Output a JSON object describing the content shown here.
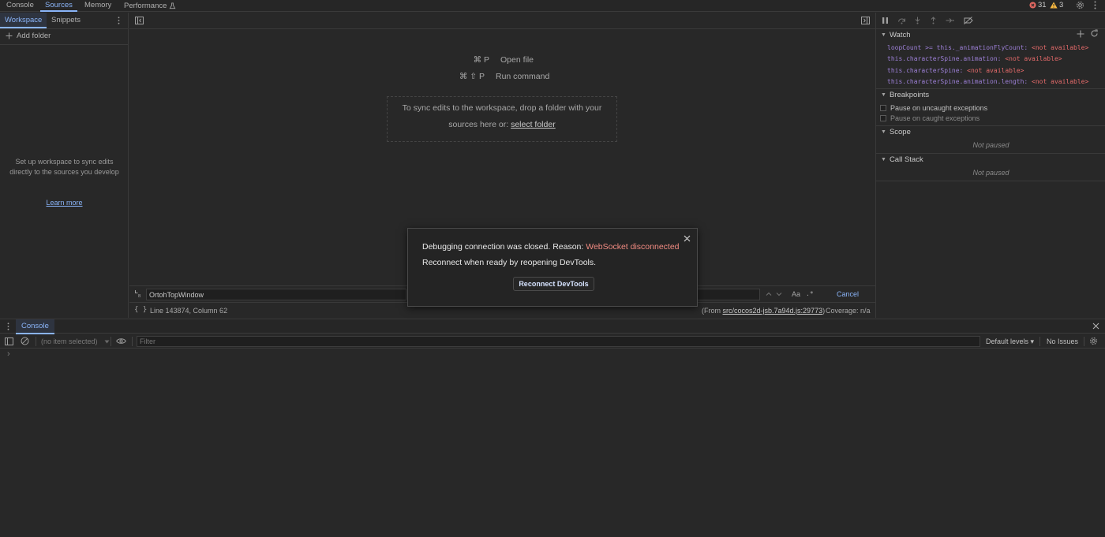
{
  "top_tabs": {
    "console": "Console",
    "sources": "Sources",
    "memory": "Memory",
    "performance": "Performance"
  },
  "top_status": {
    "errors": "31",
    "warnings": "3"
  },
  "navigator": {
    "tabs": [
      "Workspace",
      "Snippets"
    ],
    "add_folder": "Add folder",
    "hint": "Set up workspace to sync edits directly to the sources you develop",
    "learn_more": "Learn more"
  },
  "editor": {
    "shortcuts": [
      {
        "keys": "⌘ P",
        "label": "Open file"
      },
      {
        "keys": "⌘ ⇧ P",
        "label": "Run command"
      }
    ],
    "drop_text": "To sync edits to the workspace, drop a folder with your sources here or:",
    "select_folder": "select folder"
  },
  "search": {
    "value": "OrtohTopWindow",
    "case_label": "Aa",
    "regex_label": ".*",
    "cancel": "Cancel"
  },
  "status": {
    "position": "Line 143874, Column 62",
    "from_prefix": "(From ",
    "source_link": "src/cocos2d-jsb.7a94d.js:29773",
    "from_suffix": ")",
    "coverage": "Coverage: n/a"
  },
  "sidebar": {
    "watch_title": "Watch",
    "watch_items": [
      {
        "expr": "loopCount >= this._animationFlyCount:",
        "value": "<not available>"
      },
      {
        "expr": "this.characterSpine.animation:",
        "value": "<not available>"
      },
      {
        "expr": "this.characterSpine:",
        "value": "<not available>"
      },
      {
        "expr": "this.characterSpine.animation.length:",
        "value": "<not available>"
      }
    ],
    "breakpoints_title": "Breakpoints",
    "pause_uncaught": "Pause on uncaught exceptions",
    "pause_caught": "Pause on caught exceptions",
    "scope_title": "Scope",
    "scope_status": "Not paused",
    "callstack_title": "Call Stack",
    "callstack_status": "Not paused"
  },
  "modal": {
    "message_prefix": "Debugging connection was closed. Reason: ",
    "reason": "WebSocket disconnected",
    "message2": "Reconnect when ready by reopening DevTools.",
    "button": "Reconnect DevTools"
  },
  "drawer": {
    "tab": "Console",
    "context": "(no item selected)",
    "filter_placeholder": "Filter",
    "levels": "Default levels ▾",
    "issues": "No Issues",
    "prompt": "›"
  },
  "colors": {
    "accent": "#8ab4f8",
    "error": "#f28b82",
    "error_icon": "#e46962",
    "warning_icon": "#f6b740"
  }
}
